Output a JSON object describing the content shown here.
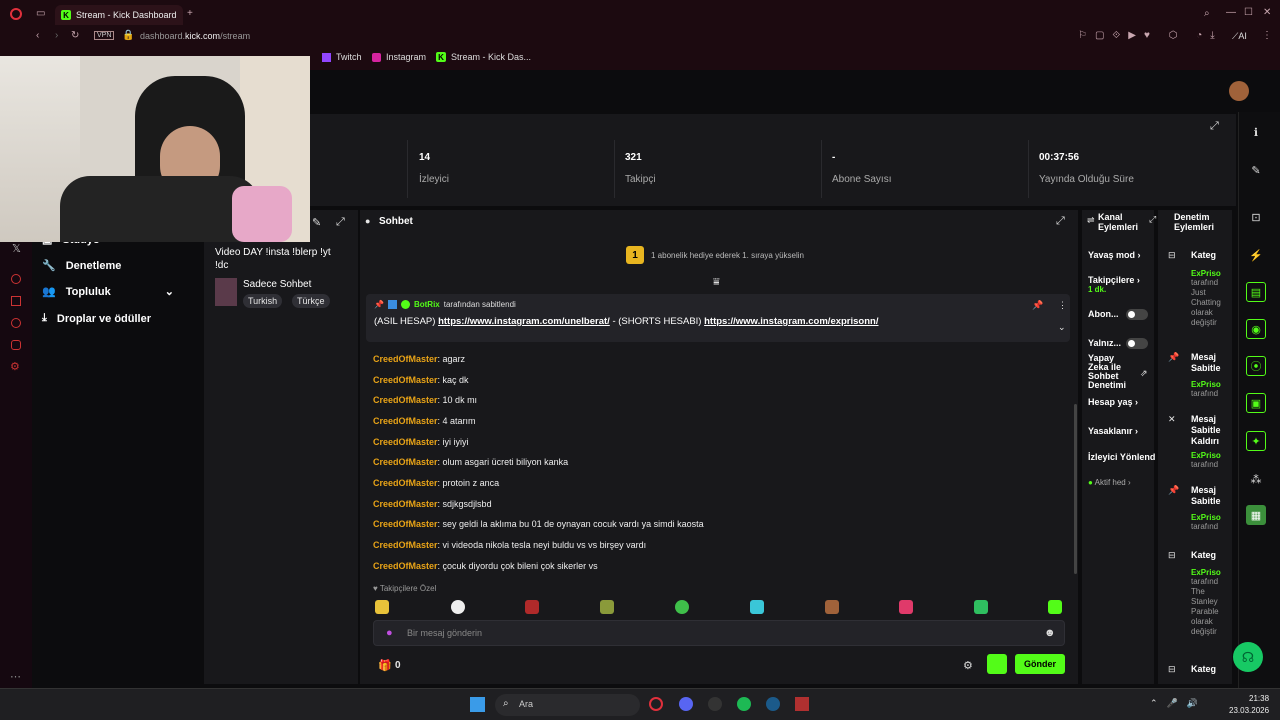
{
  "browser": {
    "tab_title": "Stream - Kick Dashboard",
    "address_prefix": "dashboard.",
    "address_domain": "kick.com",
    "address_path": "/stream",
    "vpn_label": "VPN",
    "ai_label": "AI",
    "bookmarks": [
      "Twitch",
      "Instagram",
      "Stream - Kick Das..."
    ]
  },
  "stats": [
    {
      "value": "14",
      "label": "İzleyici"
    },
    {
      "value": "321",
      "label": "Takipçi"
    },
    {
      "value": "-",
      "label": "Abone Sayısı"
    },
    {
      "value": "00:37:56",
      "label": "Yayında Olduğu Süre"
    }
  ],
  "nav": {
    "studio": "Stüdyo",
    "moderation": "Denetleme",
    "community": "Topluluk",
    "drops": "Droplar ve ödüller"
  },
  "stream_panel": {
    "title": "Video DAY !insta !blerp !yt !dc",
    "category": "Sadece Sohbet",
    "tags": [
      "Turkish",
      "Türkçe"
    ]
  },
  "chat": {
    "title": "Sohbet",
    "gift_banner": "1 abonelik hediye ederek 1. sıraya yükselin",
    "gift_rank": "1",
    "pinned_by": "BotRix",
    "pinned_suffix": "tarafından sabitlendi",
    "pinned_text_1": "(ASIL HESAP)",
    "pinned_link_1": "https://www.instagram.com/unelberat/",
    "pinned_text_2": "- (SHORTS HESABI)",
    "pinned_link_2": "https://www.instagram.com/exprisonn/",
    "messages": [
      {
        "user": "CreedOfMaster",
        "text": "agarz"
      },
      {
        "user": "CreedOfMaster",
        "text": "kaç dk"
      },
      {
        "user": "CreedOfMaster",
        "text": "10 dk mı"
      },
      {
        "user": "CreedOfMaster",
        "text": "4 atarım"
      },
      {
        "user": "CreedOfMaster",
        "text": "iyi iyiyi"
      },
      {
        "user": "CreedOfMaster",
        "text": "olum asgari ücreti biliyon kanka"
      },
      {
        "user": "CreedOfMaster",
        "text": "protoin z anca"
      },
      {
        "user": "CreedOfMaster",
        "text": "sdjkgsdjlsbd"
      },
      {
        "user": "CreedOfMaster",
        "text": "sey geldi la aklıma bu 01 de oynayan cocuk vardı ya simdi kaosta"
      },
      {
        "user": "CreedOfMaster",
        "text": "vi videoda nikola tesla neyi buldu vs vs birşey vardı"
      },
      {
        "user": "CreedOfMaster",
        "text": "çocuk diyordu çok bileni çok sikerler vs"
      }
    ],
    "followers_only": "Takipçilere Özel",
    "input_placeholder": "Bir mesaj gönderin",
    "points": "0",
    "send_button": "Gönder"
  },
  "mod_panel": {
    "title": "Kanal Eylemleri",
    "slow_mode": "Yavaş mod",
    "followers": "Takipçilere",
    "followers_sub": "1 dk.",
    "subscribers": "Abon...",
    "only": "Yalnız...",
    "ai_moderation": "Yapay Zeka ile Sohbet Denetimi",
    "account_age": "Hesap yaş",
    "bans": "Yasaklanır",
    "viewer_mgmt": "İzleyici Yönlend",
    "active": "Aktif hed"
  },
  "actions_panel": {
    "title": "Denetim Eylemleri",
    "items": [
      {
        "title": "Kateg",
        "user": "ExPriso",
        "detail": "tarafınd\nJust\nChatting\nolarak\ndeğiştir"
      },
      {
        "title": "Mesaj\nSabitle",
        "user": "ExPriso",
        "detail": "tarafınd"
      },
      {
        "title": "Mesaj\nSabitle\nKaldırı",
        "user": "ExPriso",
        "detail": "tarafınd"
      },
      {
        "title": "Mesaj\nSabitle",
        "user": "ExPriso",
        "detail": "tarafınd"
      },
      {
        "title": "Kateg",
        "user": "ExPriso",
        "detail": "tarafınd\nThe\nStanley\nParable\nolarak\ndeğiştir"
      },
      {
        "title": "Kateg",
        "user": "",
        "detail": ""
      }
    ]
  },
  "taskbar": {
    "search": "Ara",
    "time": "21:38",
    "date": "23.03.2026"
  },
  "colors": {
    "accent": "#53fc18",
    "username": "#e8a317"
  }
}
